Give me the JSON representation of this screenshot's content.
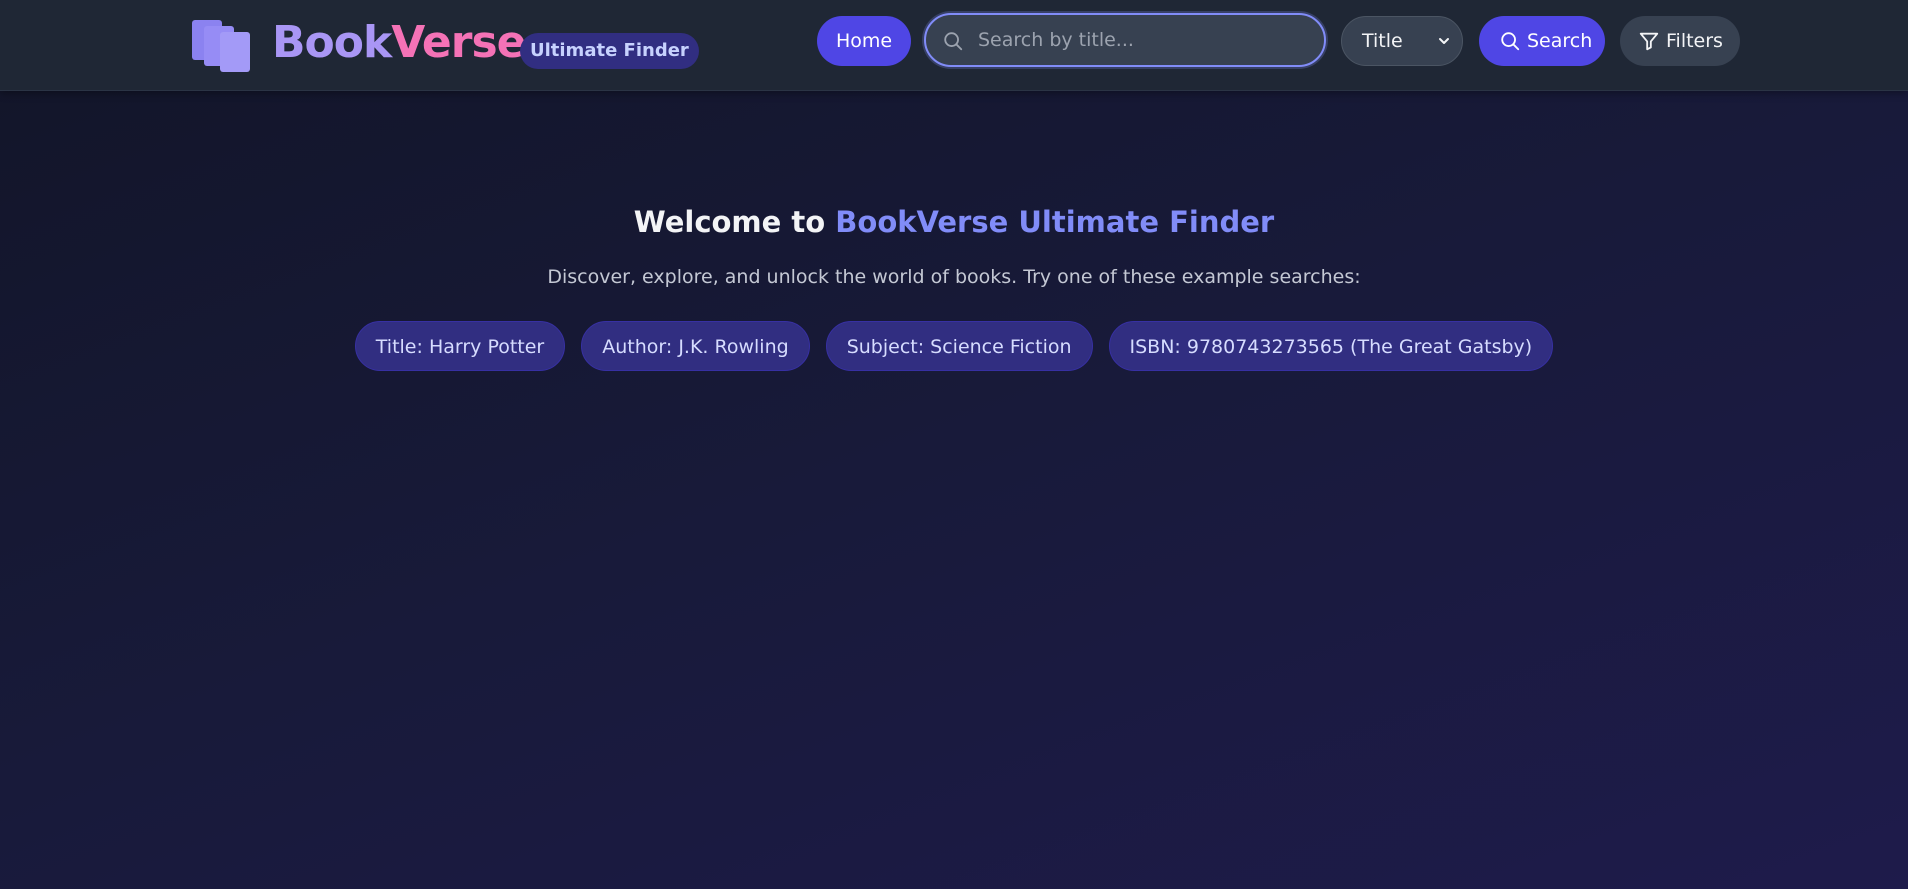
{
  "header": {
    "brand_part1": "Book",
    "brand_part2": "Verse",
    "badge": "Ultimate Finder",
    "home_label": "Home",
    "search_placeholder": "Search by title...",
    "search_type_selected": "Title",
    "search_label": "Search",
    "filters_label": "Filters"
  },
  "main": {
    "welcome_prefix": "Welcome to ",
    "welcome_highlight": "BookVerse Ultimate Finder",
    "subtitle": "Discover, explore, and unlock the world of books. Try one of these example searches:",
    "examples": [
      "Title: Harry Potter",
      "Author: J.K. Rowling",
      "Subject: Science Fiction",
      "ISBN: 9780743273565 (The Great Gatsby)"
    ]
  },
  "colors": {
    "accent": "#4f46e5",
    "brand_purple": "#a996f5",
    "brand_pink": "#f472b6",
    "highlight": "#818cf8",
    "chip_bg": "#312e81"
  },
  "icons": {
    "logo": "books-stack-icon",
    "search": "magnifier-icon",
    "filters": "funnel-icon",
    "select": "chevron-down-icon"
  }
}
